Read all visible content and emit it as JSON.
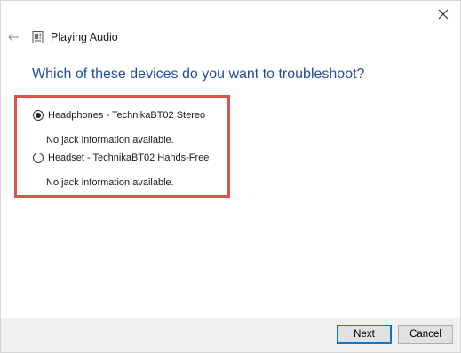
{
  "header": {
    "title": "Playing Audio"
  },
  "question": "Which of these devices do you want to troubleshoot?",
  "devices": [
    {
      "label": "Headphones - TechnikaBT02 Stereo",
      "description": "No jack information available.",
      "selected": true
    },
    {
      "label": "Headset - TechnikaBT02 Hands-Free",
      "description": "No jack information available.",
      "selected": false
    }
  ],
  "footer": {
    "next_label": "Next",
    "cancel_label": "Cancel"
  },
  "colors": {
    "question": "#1f4e9a",
    "highlight_border": "#d9534f",
    "primary_button_border": "#0078d7"
  },
  "icons": {
    "close": "close-icon",
    "back": "back-arrow-icon",
    "app": "audio-troubleshooter-icon"
  }
}
